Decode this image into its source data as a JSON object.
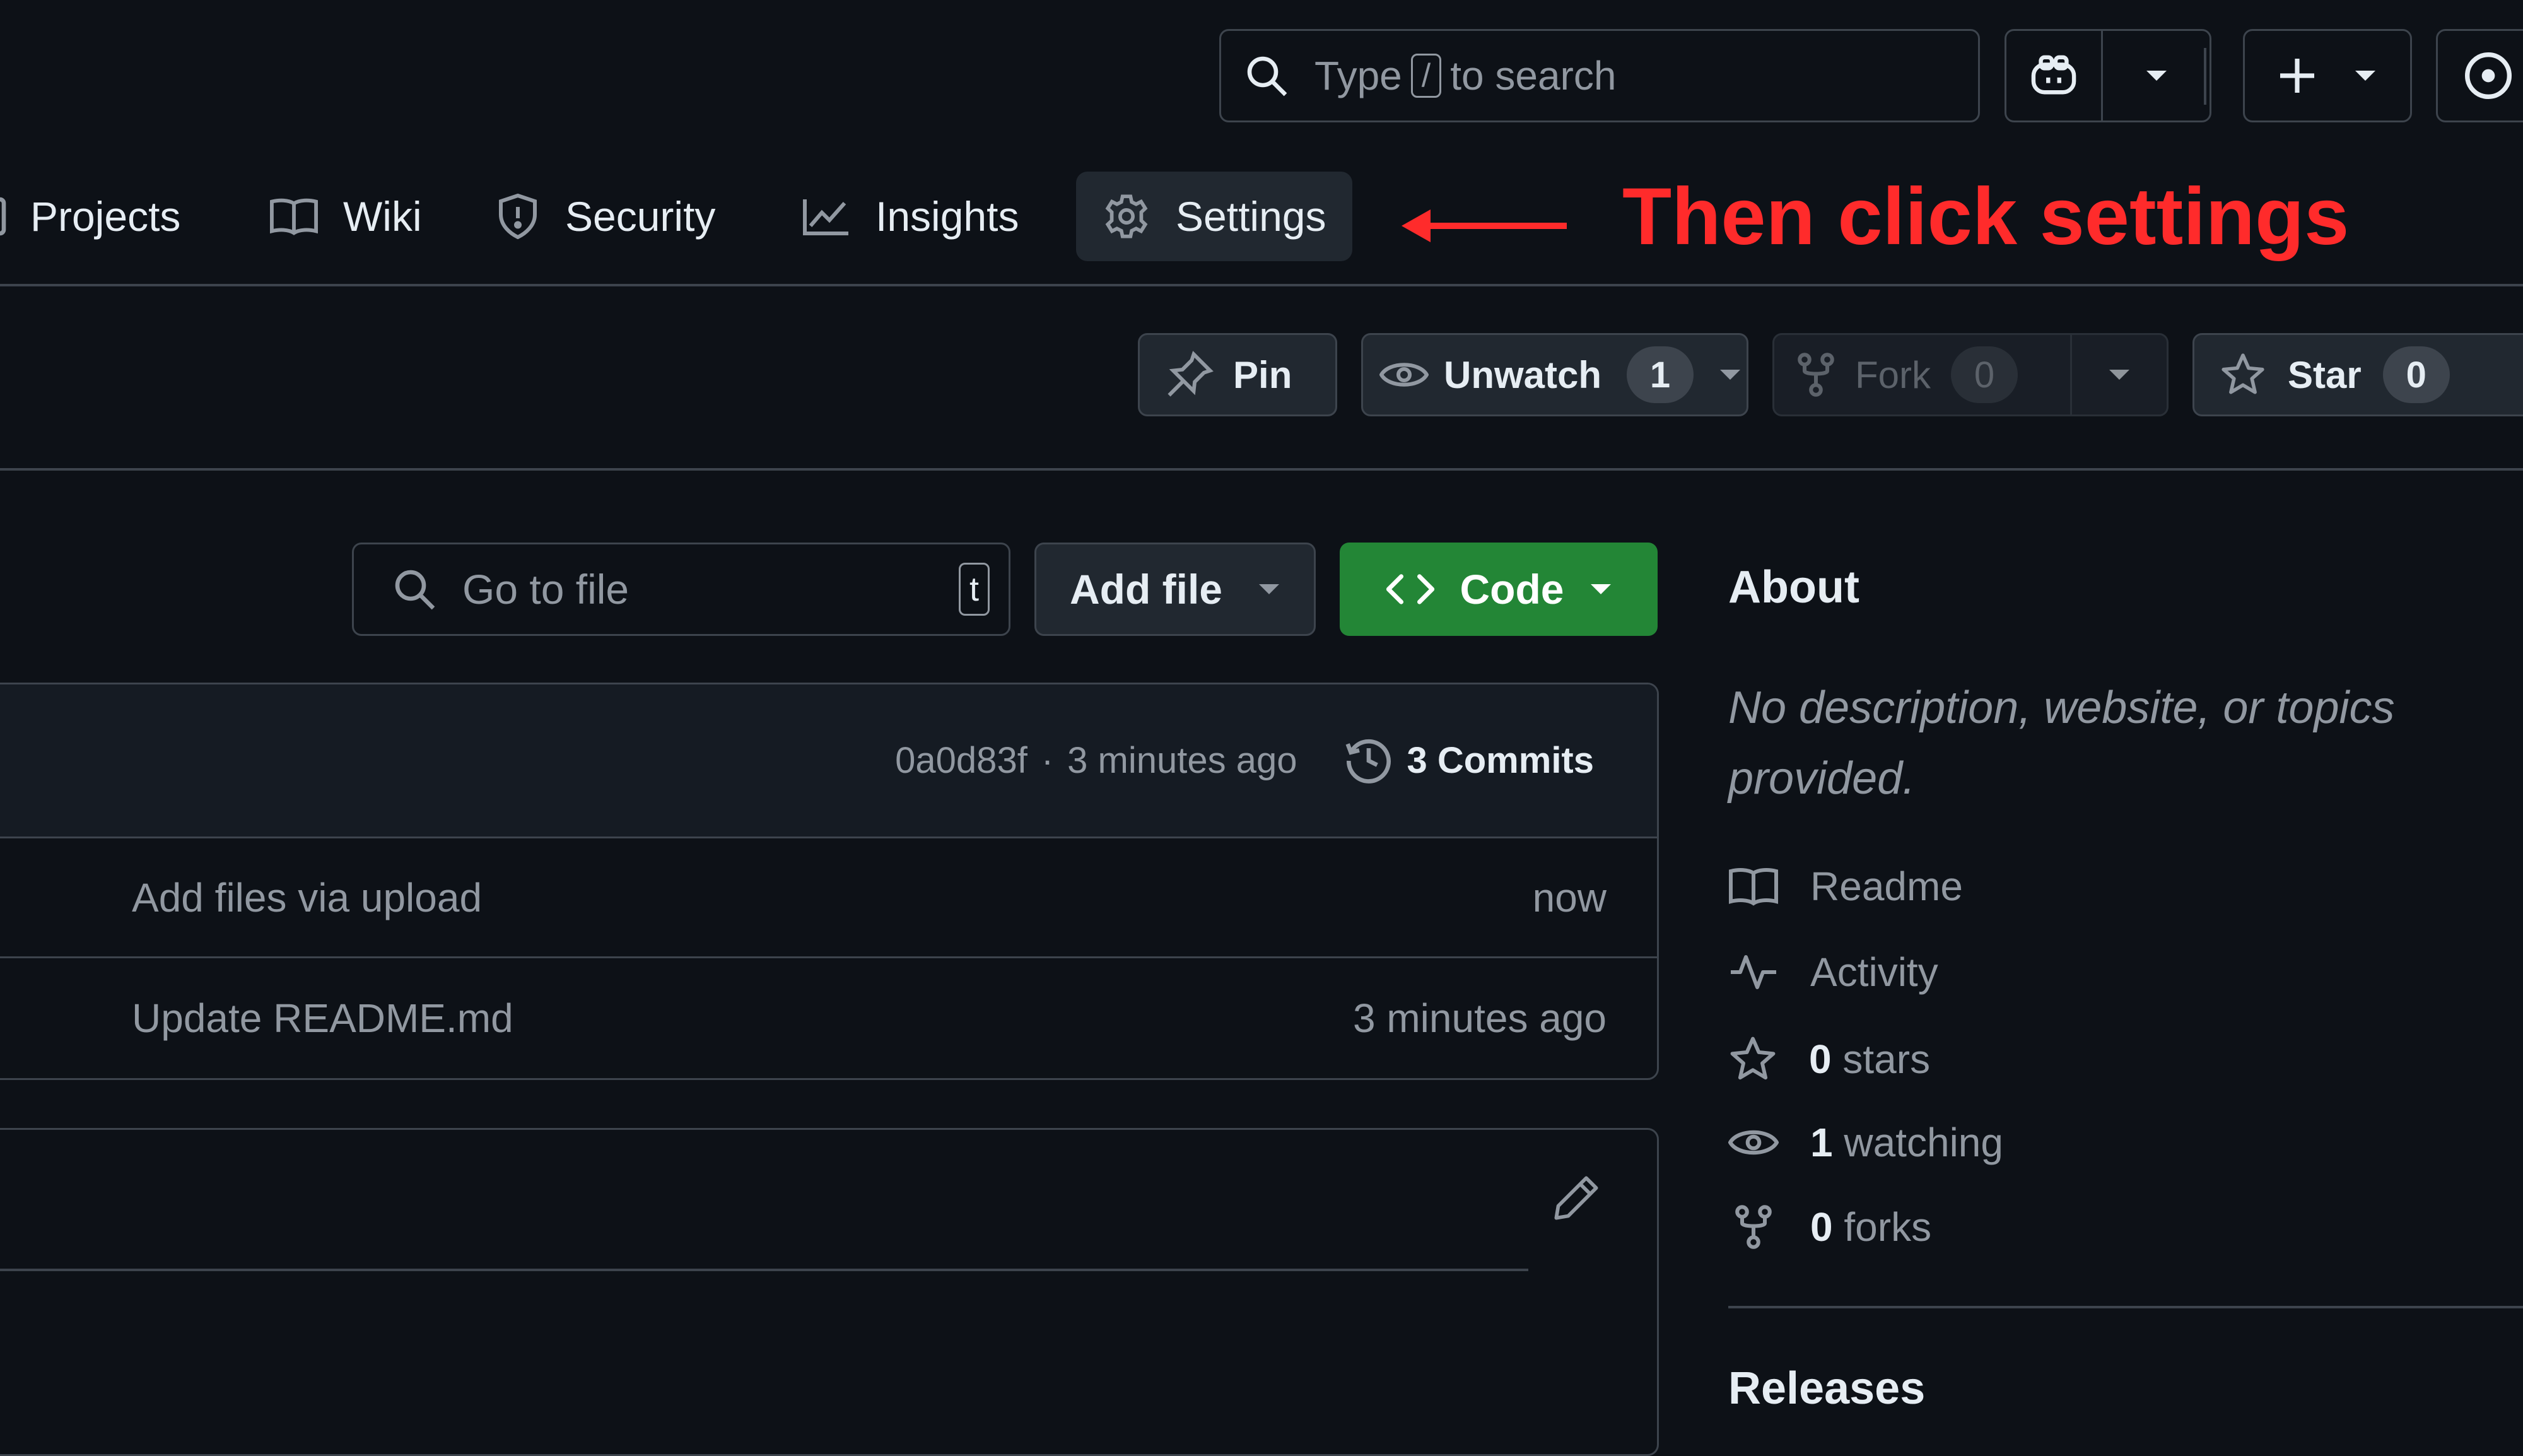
{
  "header": {
    "search_prefix": "Type",
    "search_key": "/",
    "search_suffix": "to search"
  },
  "nav": {
    "items": [
      {
        "label": "Projects",
        "icon": "project-icon"
      },
      {
        "label": "Wiki",
        "icon": "book-icon"
      },
      {
        "label": "Security",
        "icon": "shield-icon"
      },
      {
        "label": "Insights",
        "icon": "graph-icon"
      },
      {
        "label": "Settings",
        "icon": "gear-icon",
        "selected": true
      }
    ]
  },
  "annotation": {
    "text": "Then click settings",
    "color": "#ff2b2b"
  },
  "actions": {
    "pin": "Pin",
    "unwatch": "Unwatch",
    "unwatch_count": "1",
    "fork": "Fork",
    "fork_count": "0",
    "star": "Star",
    "star_count": "0"
  },
  "toolbar": {
    "goto_placeholder": "Go to file",
    "goto_key": "t",
    "add_file": "Add file",
    "code": "Code",
    "code_color": "#238636"
  },
  "commit_bar": {
    "hash": "0a0d83f",
    "separator": "·",
    "time": "3 minutes ago",
    "commits": "3 Commits"
  },
  "files": [
    {
      "message": "Add files via upload",
      "time": "now"
    },
    {
      "message": "Update README.md",
      "time": "3 minutes ago"
    }
  ],
  "sidebar": {
    "about_title": "About",
    "description": "No description, website, or topics provided.",
    "readme": "Readme",
    "activity": "Activity",
    "stars_count": "0",
    "stars_label": "stars",
    "watching_count": "1",
    "watching_label": "watching",
    "forks_count": "0",
    "forks_label": "forks",
    "releases_title": "Releases"
  },
  "colors": {
    "background": "#0d1117",
    "border": "#3d444d",
    "text": "#e6edf3",
    "muted": "#9198a1"
  }
}
